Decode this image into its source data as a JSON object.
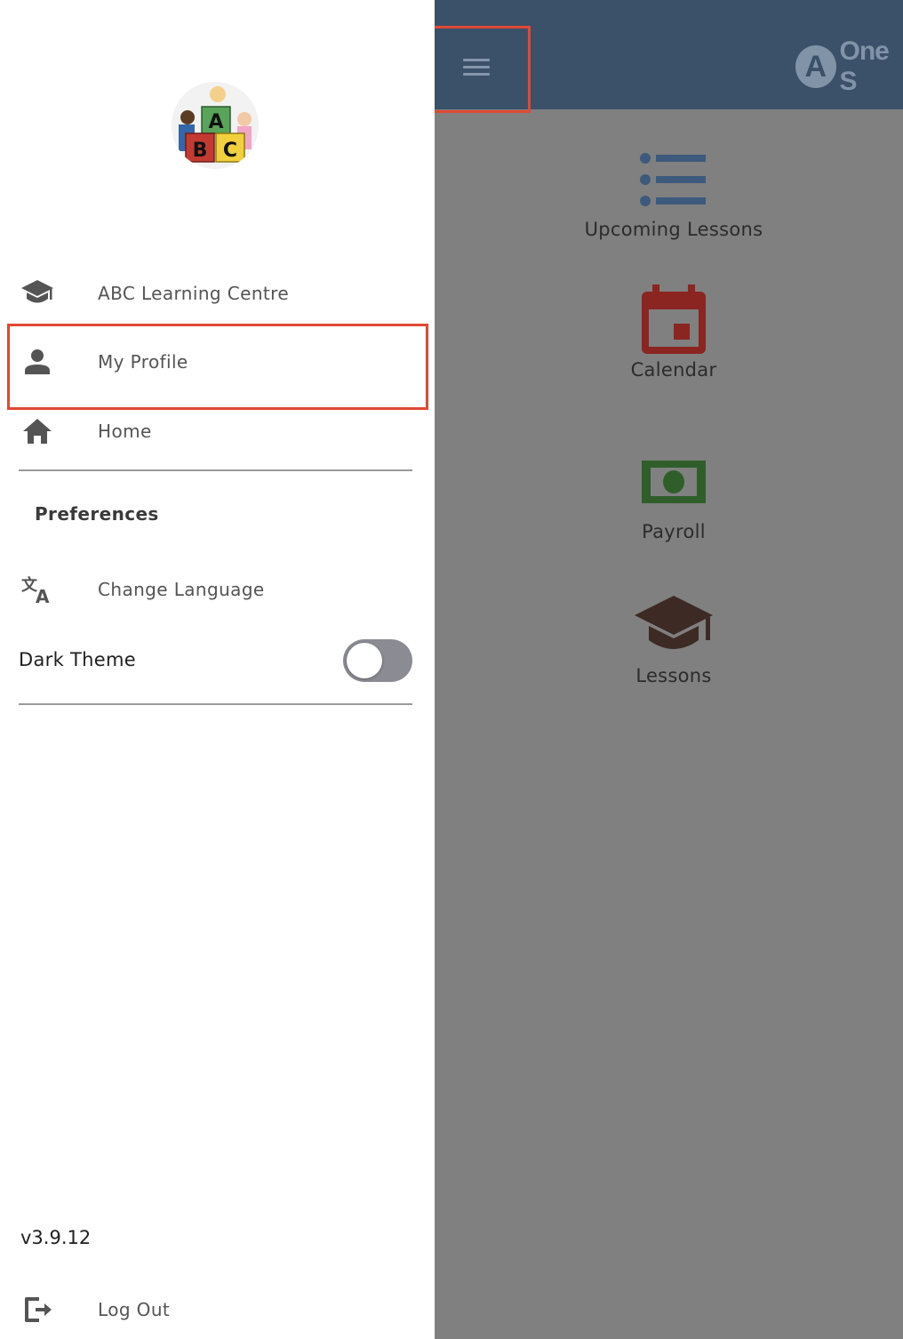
{
  "header": {
    "brand_mark": "A",
    "brand_text": "One S"
  },
  "home_tiles": [
    {
      "label": "Upcoming Lessons",
      "icon": "list-icon",
      "color": "#3d5a7c"
    },
    {
      "label": "Calendar",
      "icon": "calendar-icon",
      "color": "#8a2522"
    },
    {
      "label": "Payroll",
      "icon": "money-icon",
      "color": "#2f5e2a"
    },
    {
      "label": "Lessons",
      "icon": "graduation-cap-icon",
      "color": "#3d2a24"
    }
  ],
  "drawer": {
    "logo": {
      "icon": "abc-blocks-logo",
      "letters": [
        "A",
        "B",
        "C"
      ]
    },
    "items": [
      {
        "label": "ABC Learning Centre",
        "icon": "school-icon"
      },
      {
        "label": "My Profile",
        "icon": "person-icon"
      },
      {
        "label": "Home",
        "icon": "home-icon"
      }
    ],
    "preferences": {
      "title": "Preferences",
      "change_language": "Change Language",
      "dark_theme": "Dark Theme",
      "dark_theme_enabled": false
    },
    "version": "v3.9.12",
    "logout": "Log Out"
  },
  "colors": {
    "header_bg": "#3b5169",
    "overlay_bg": "#808080",
    "highlight": "#e04a35",
    "drawer_text": "#545454"
  }
}
